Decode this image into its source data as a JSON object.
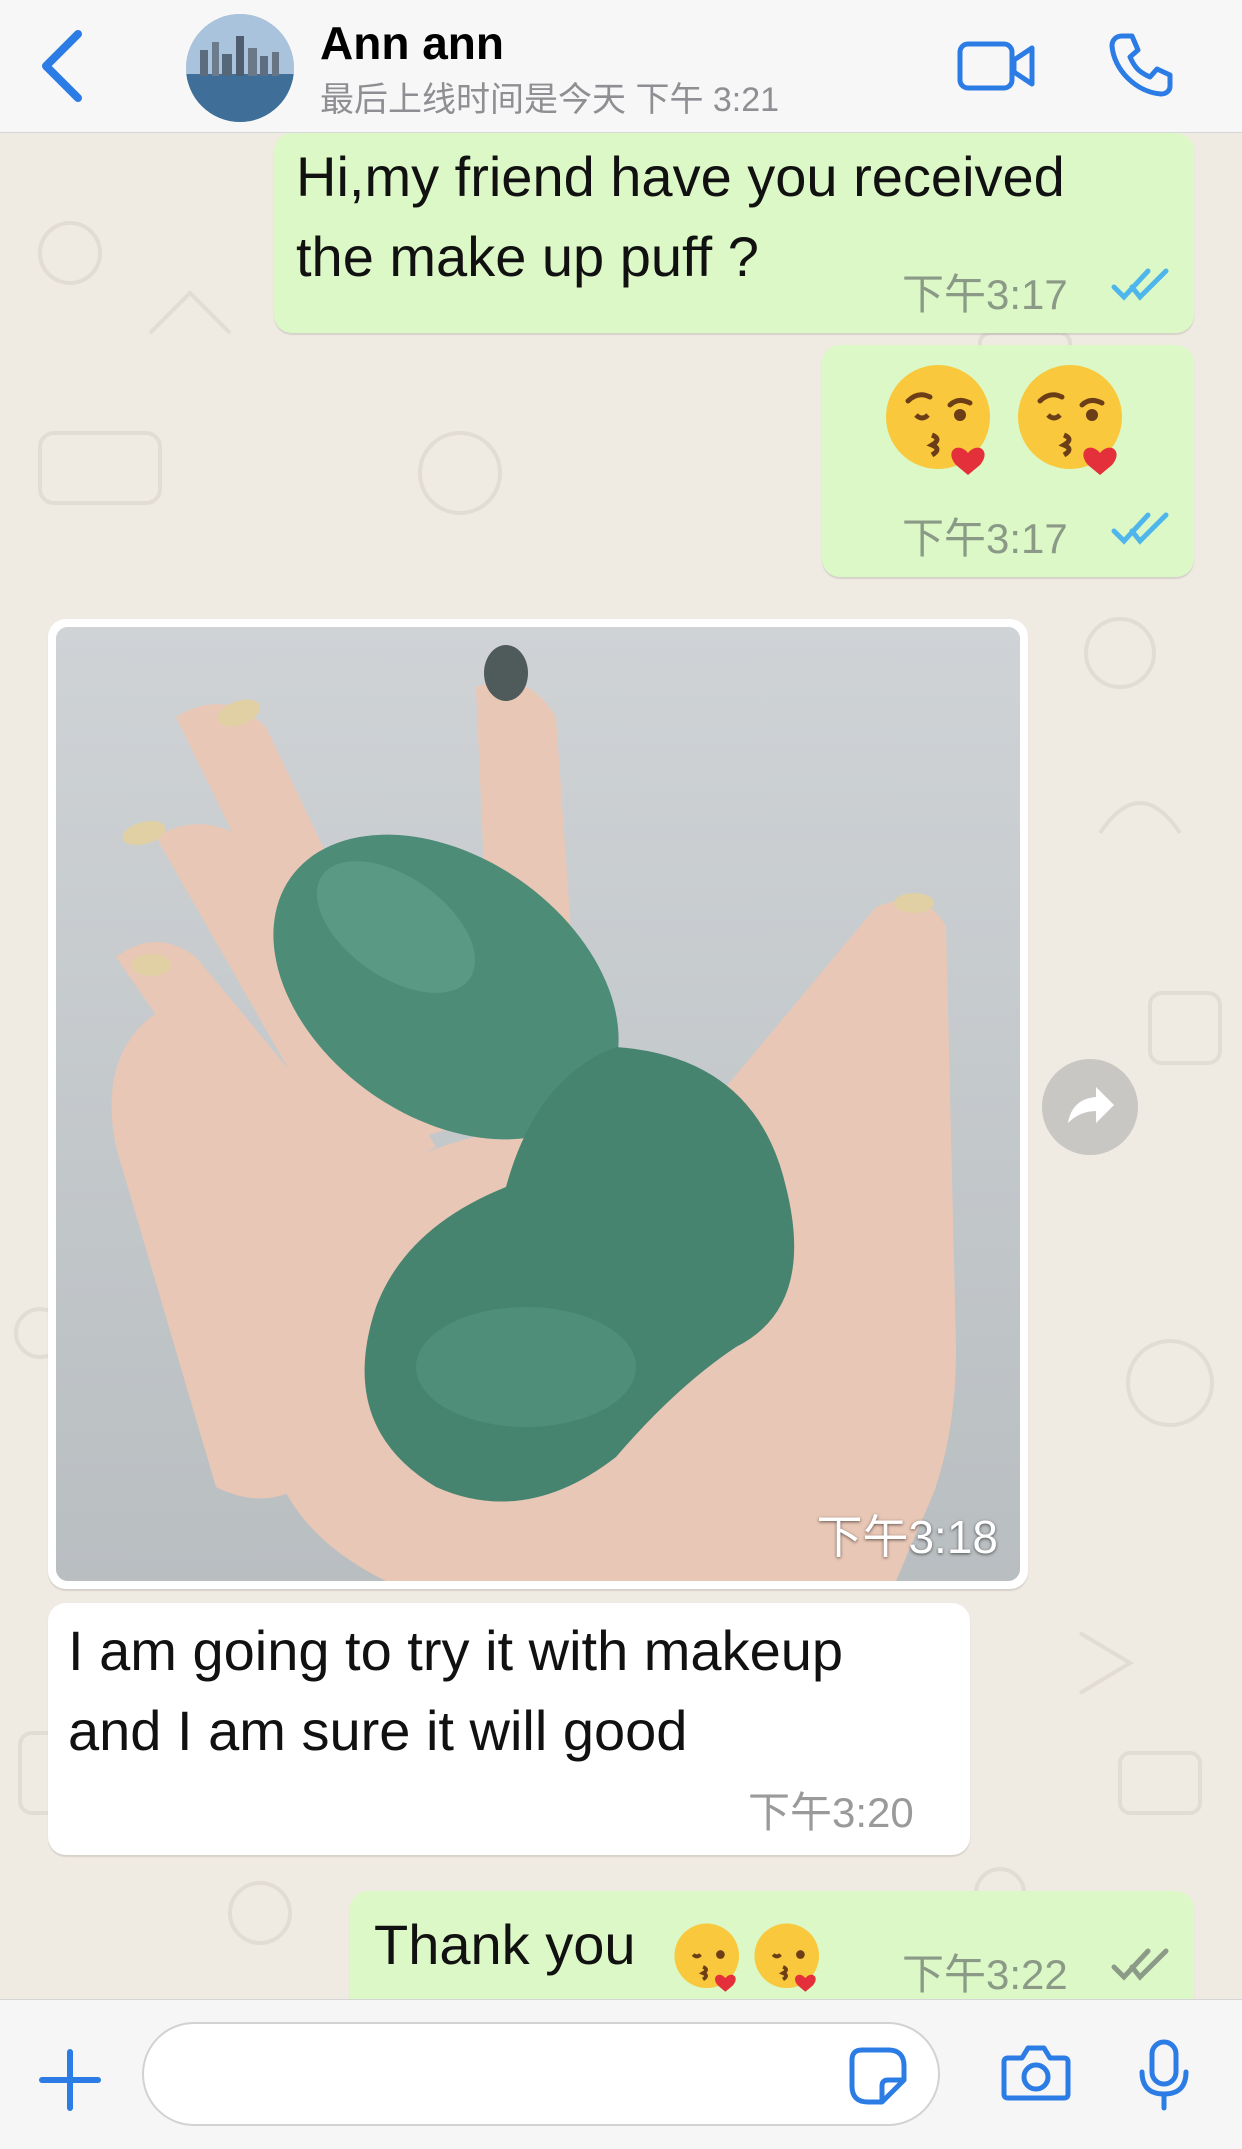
{
  "header": {
    "contact_name": "Ann ann",
    "last_seen": "最后上线时间是今天 下午 3:21",
    "back_icon": "chevron-left-icon",
    "video_icon": "video-camera-icon",
    "call_icon": "phone-icon"
  },
  "messages": [
    {
      "direction": "outgoing",
      "lines": [
        "Hi,my friend have you received",
        "the make up puff ?"
      ],
      "time": "下午3:17",
      "status": "read"
    },
    {
      "direction": "outgoing",
      "emoji": [
        "kissing-face-with-heart",
        "kissing-face-with-heart"
      ],
      "time": "下午3:17",
      "status": "read"
    },
    {
      "direction": "incoming",
      "type": "image",
      "image_alt": "hand holding two green makeup sponges",
      "time": "下午3:18"
    },
    {
      "direction": "incoming",
      "lines": [
        "I am going to try it with makeup",
        "and I am sure it will good"
      ],
      "time": "下午3:20"
    },
    {
      "direction": "outgoing",
      "text": "Thank you",
      "emoji": [
        "kissing-face-with-heart",
        "kissing-face-with-heart"
      ],
      "time": "下午3:22",
      "status": "delivered"
    }
  ],
  "input_bar": {
    "placeholder": "",
    "plus_icon": "plus-icon",
    "sticker_icon": "sticker-icon",
    "camera_icon": "camera-icon",
    "mic_icon": "microphone-icon"
  },
  "colors": {
    "accent": "#2c7ce5",
    "outgoing_bubble": "#dcf8c6",
    "incoming_bubble": "#ffffff",
    "chat_background": "#efeae2",
    "read_ticks": "#4fb6ec",
    "delivered_ticks": "#8c9a88"
  }
}
